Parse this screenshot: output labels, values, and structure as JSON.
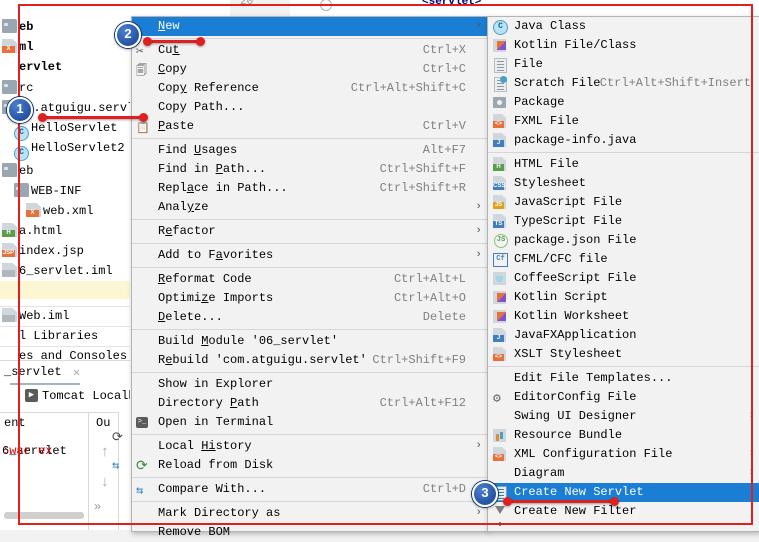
{
  "editor": {
    "line_number": "20",
    "code": "<servlet>"
  },
  "project_tree": {
    "items": [
      {
        "label": "eb",
        "icon": "folder-icon",
        "bold": true,
        "indent": 0
      },
      {
        "label": "ml",
        "icon": "xml-file-icon",
        "bold": true,
        "indent": 0
      },
      {
        "label": "ervlet",
        "icon": "module-icon",
        "bold": true,
        "indent": 0
      },
      {
        "label": "rc",
        "icon": "source-folder-icon",
        "bold": false,
        "indent": 0
      },
      {
        "label": "om.atguigu.servl",
        "icon": "package-icon",
        "bold": false,
        "indent": 0
      },
      {
        "label": "HelloServlet",
        "icon": "java-class-icon",
        "bold": false,
        "indent": 1
      },
      {
        "label": "HelloServlet2",
        "icon": "java-class-icon",
        "bold": false,
        "indent": 1
      },
      {
        "label": "eb",
        "icon": "folder-icon",
        "bold": false,
        "indent": 0
      },
      {
        "label": "WEB-INF",
        "icon": "folder-icon",
        "bold": false,
        "indent": 1
      },
      {
        "label": "web.xml",
        "icon": "xml-file-icon",
        "bold": false,
        "indent": 2
      },
      {
        "label": "a.html",
        "icon": "html-file-icon",
        "bold": false,
        "indent": 0
      },
      {
        "label": "index.jsp",
        "icon": "jsp-file-icon",
        "bold": false,
        "indent": 0
      },
      {
        "label": "6_servlet.iml",
        "icon": "iml-file-icon",
        "bold": false,
        "indent": 0
      },
      {
        "label": "Web.iml",
        "icon": "iml-file-icon",
        "bold": false,
        "indent": 0
      },
      {
        "label": "l Libraries",
        "icon": "library-icon",
        "bold": false,
        "indent": 0
      },
      {
        "label": "es and Consoles",
        "icon": "scratch-icon",
        "bold": false,
        "indent": 0
      }
    ]
  },
  "run_panel": {
    "tab_label": "_servlet",
    "close_icon": "close-icon",
    "config_name": "Tomcat Localho",
    "config_run_icon": "run-icon",
    "output_header_left": "ent",
    "output_header_right": "Ou",
    "artifact_row_prefix": "6_servlet",
    "artifact_row_suffix": ":war ex",
    "up_arrow": "↑",
    "down_arrow": "↓",
    "expand_chevrons": "»"
  },
  "context_menu": {
    "items": [
      {
        "label": "New",
        "mnemonic": "N",
        "accel": "",
        "arrow": true,
        "selected": true,
        "icon": ""
      },
      {
        "sep": true
      },
      {
        "label": "Cut",
        "mnemonic": "t",
        "accel": "Ctrl+X",
        "icon": "scissors-icon"
      },
      {
        "label": "Copy",
        "mnemonic": "C",
        "accel": "Ctrl+C",
        "icon": "copy-icon"
      },
      {
        "label": "Copy Reference",
        "mnemonic": "y",
        "accel": "Ctrl+Alt+Shift+C",
        "icon": ""
      },
      {
        "label": "Copy Path...",
        "accel": "",
        "icon": ""
      },
      {
        "label": "Paste",
        "mnemonic": "P",
        "accel": "Ctrl+V",
        "icon": "paste-icon"
      },
      {
        "sep": true
      },
      {
        "label": "Find Usages",
        "mnemonic": "U",
        "accel": "Alt+F7",
        "icon": ""
      },
      {
        "label": "Find in Path...",
        "mnemonic": "P",
        "accel": "Ctrl+Shift+F",
        "icon": ""
      },
      {
        "label": "Replace in Path...",
        "mnemonic": "a",
        "accel": "Ctrl+Shift+R",
        "icon": ""
      },
      {
        "label": "Analyze",
        "mnemonic": "y",
        "accel": "",
        "arrow": true,
        "icon": ""
      },
      {
        "sep": true
      },
      {
        "label": "Refactor",
        "mnemonic": "e",
        "accel": "",
        "arrow": true,
        "icon": ""
      },
      {
        "sep": true
      },
      {
        "label": "Add to Favorites",
        "mnemonic": "a",
        "accel": "",
        "arrow": true,
        "icon": ""
      },
      {
        "sep": true
      },
      {
        "label": "Reformat Code",
        "mnemonic": "R",
        "accel": "Ctrl+Alt+L",
        "icon": ""
      },
      {
        "label": "Optimize Imports",
        "mnemonic": "z",
        "accel": "Ctrl+Alt+O",
        "icon": ""
      },
      {
        "label": "Delete...",
        "mnemonic": "D",
        "accel": "Delete",
        "icon": ""
      },
      {
        "sep": true
      },
      {
        "label": "Build Module '06_servlet'",
        "mnemonic": "M",
        "accel": "",
        "icon": ""
      },
      {
        "label": "Rebuild 'com.atguigu.servlet'",
        "mnemonic": "e",
        "accel": "Ctrl+Shift+F9",
        "icon": ""
      },
      {
        "sep": true
      },
      {
        "label": "Show in Explorer",
        "accel": "",
        "icon": ""
      },
      {
        "label": "Directory Path",
        "mnemonic": "P",
        "accel": "Ctrl+Alt+F12",
        "icon": ""
      },
      {
        "label": "Open in Terminal",
        "accel": "",
        "icon": "terminal-icon"
      },
      {
        "sep": true
      },
      {
        "label": "Local History",
        "mnemonic": "Hi",
        "accel": "",
        "arrow": true,
        "icon": ""
      },
      {
        "label": "Reload from Disk",
        "accel": "",
        "icon": "reload-icon"
      },
      {
        "sep": true
      },
      {
        "label": "Compare With...",
        "accel": "Ctrl+D",
        "icon": "compare-icon"
      },
      {
        "sep": true
      },
      {
        "label": "Mark Directory as",
        "accel": "",
        "arrow": true,
        "icon": ""
      },
      {
        "label": "Remove BOM",
        "accel": "",
        "icon": ""
      }
    ]
  },
  "new_submenu": {
    "items": [
      {
        "label": "Java Class",
        "accel": "",
        "icon": "java-class-icon"
      },
      {
        "label": "Kotlin File/Class",
        "accel": "",
        "icon": "kotlin-file-icon"
      },
      {
        "label": "File",
        "accel": "",
        "icon": "plain-file-icon"
      },
      {
        "label": "Scratch File",
        "accel": "Ctrl+Alt+Shift+Insert",
        "icon": "scratch-file-icon"
      },
      {
        "label": "Package",
        "accel": "",
        "icon": "package-icon"
      },
      {
        "label": "FXML File",
        "accel": "",
        "icon": "fxml-file-icon"
      },
      {
        "label": "package-info.java",
        "accel": "",
        "icon": "java-file-icon"
      },
      {
        "sep": true
      },
      {
        "label": "HTML File",
        "accel": "",
        "icon": "html-file-icon"
      },
      {
        "label": "Stylesheet",
        "accel": "",
        "icon": "css-file-icon"
      },
      {
        "label": "JavaScript File",
        "accel": "",
        "icon": "js-file-icon"
      },
      {
        "label": "TypeScript File",
        "accel": "",
        "icon": "ts-file-icon"
      },
      {
        "label": "package.json File",
        "accel": "",
        "icon": "json-file-icon"
      },
      {
        "label": "CFML/CFC file",
        "accel": "",
        "icon": "cfml-file-icon"
      },
      {
        "label": "CoffeeScript File",
        "accel": "",
        "icon": "coffeescript-file-icon"
      },
      {
        "label": "Kotlin Script",
        "accel": "",
        "icon": "kotlin-script-icon"
      },
      {
        "label": "Kotlin Worksheet",
        "accel": "",
        "icon": "kotlin-worksheet-icon"
      },
      {
        "label": "JavaFXApplication",
        "accel": "",
        "icon": "javafx-file-icon"
      },
      {
        "label": "XSLT Stylesheet",
        "accel": "",
        "icon": "xslt-file-icon"
      },
      {
        "sep": true
      },
      {
        "label": "Edit File Templates...",
        "accel": "",
        "icon": ""
      },
      {
        "label": "EditorConfig File",
        "accel": "",
        "icon": "gear-icon"
      },
      {
        "label": "Swing UI Designer",
        "accel": "",
        "arrow": true,
        "icon": ""
      },
      {
        "label": "Resource Bundle",
        "accel": "",
        "icon": "resource-bundle-icon"
      },
      {
        "label": "XML Configuration File",
        "accel": "",
        "arrow": true,
        "icon": "xml-file-icon"
      },
      {
        "label": "Diagram",
        "accel": "",
        "arrow": true,
        "icon": ""
      },
      {
        "label": "Create New Servlet",
        "accel": "",
        "icon": "servlet-icon",
        "selected": true
      },
      {
        "label": "Create New Filter",
        "accel": "",
        "icon": "filter-icon"
      }
    ]
  },
  "annotations": {
    "callouts": [
      {
        "number": "1",
        "target": "package-node"
      },
      {
        "number": "2",
        "target": "new-menu-item"
      },
      {
        "number": "3",
        "target": "create-new-servlet-item"
      }
    ]
  },
  "colors": {
    "selection_blue": "#1a7fd4",
    "annotation_red": "#e02020",
    "callout_blue": "#16408f",
    "menu_bg": "#f2f2f2"
  }
}
